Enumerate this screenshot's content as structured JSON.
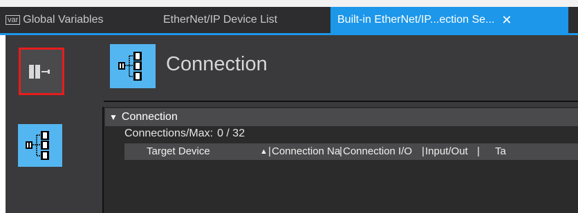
{
  "tabs": [
    {
      "badge": "var",
      "label": "Global Variables"
    },
    {
      "label": "EtherNet/IP Device List"
    },
    {
      "label": "Built-in EtherNet/IP...ection Se...",
      "close": "✕",
      "active": true
    }
  ],
  "sidebar": {
    "items": [
      {
        "icon": "device-icon",
        "selected": true
      },
      {
        "icon": "connection-tree-icon",
        "selected": false
      }
    ]
  },
  "header": {
    "icon": "connection-tree-icon",
    "title": "Connection"
  },
  "section": {
    "toggle": "▼",
    "title": "Connection",
    "count_label": "Connections/Max:",
    "count_value": "0 / 32"
  },
  "table": {
    "columns": [
      "Target Device",
      "Connection Na",
      "Connection I/O",
      "Input/Out",
      "Ta"
    ],
    "sort_indicator": "▲",
    "rows": []
  },
  "colors": {
    "accent": "#1c97ea",
    "panel": "#3a3a3c",
    "icon_bg": "#54b6f0",
    "selection_border": "#e81c1c"
  }
}
